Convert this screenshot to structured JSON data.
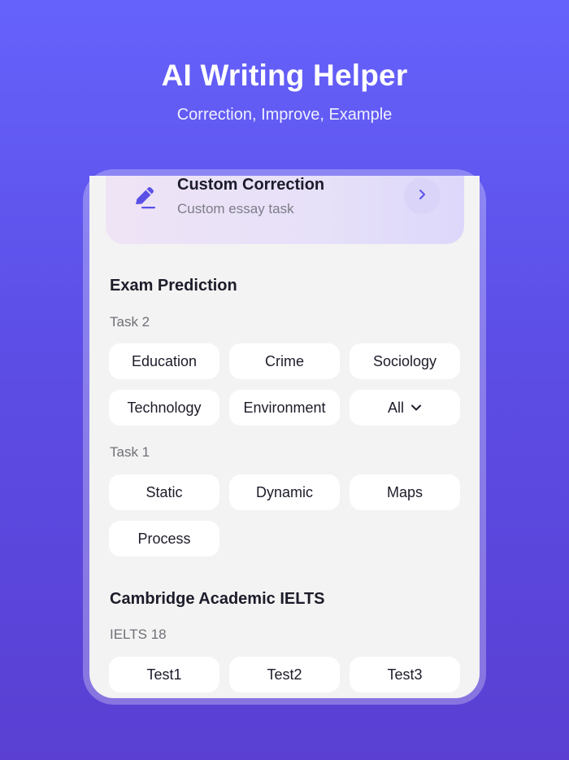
{
  "hero": {
    "title": "AI Writing Helper",
    "subtitle": "Correction, Improve, Example"
  },
  "custom_card": {
    "title": "Custom Correction",
    "subtitle": "Custom essay task",
    "icon": "pencil-icon",
    "action_icon": "chevron-right-icon"
  },
  "exam_prediction": {
    "title": "Exam Prediction",
    "task2": {
      "label": "Task 2",
      "chips": [
        "Education",
        "Crime",
        "Sociology",
        "Technology",
        "Environment",
        "All"
      ]
    },
    "task1": {
      "label": "Task 1",
      "chips": [
        "Static",
        "Dynamic",
        "Maps",
        "Process"
      ]
    }
  },
  "cambridge": {
    "title": "Cambridge Academic IELTS",
    "subtitle": "IELTS 18",
    "tests": [
      "Test1",
      "Test2",
      "Test3"
    ]
  },
  "colors": {
    "accent": "#5b50e6",
    "background_top": "#6562fb",
    "background_bottom": "#5a3fd2",
    "chip_bg": "#ffffff",
    "screen_bg": "#f3f3f3"
  }
}
